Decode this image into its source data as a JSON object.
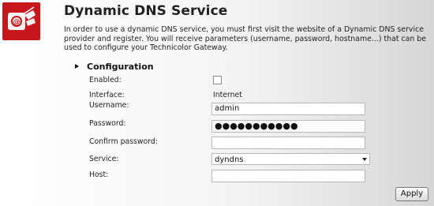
{
  "header": {
    "title": "Dynamic DNS Service",
    "description": "In order to use a dynamic DNS service, you must first visit the website of a Dynamic DNS service provider and register. You will receive parameters (username, password, hostname...) that can be used to configure your Technicolor Gateway."
  },
  "section": {
    "title": "Configuration"
  },
  "form": {
    "enabled_label": "Enabled:",
    "enabled_checked": false,
    "interface_label": "Interface:",
    "interface_value": "Internet",
    "username_label": "Username:",
    "username_value": "admin",
    "password_label": "Password:",
    "password_value": "●●●●●●●●●●●",
    "confirm_label": "Confirm password:",
    "confirm_value": "",
    "service_label": "Service:",
    "service_value": "dyndns",
    "host_label": "Host:",
    "host_value": ""
  },
  "actions": {
    "apply_label": "Apply"
  },
  "colors": {
    "logo_background": "#c8161d"
  },
  "icons": {
    "logo": "dns-service-icon"
  }
}
